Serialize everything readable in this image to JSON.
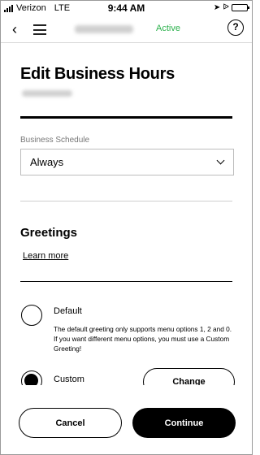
{
  "status_bar": {
    "carrier": "Verizon",
    "network": "LTE",
    "time": "9:44 AM"
  },
  "nav": {
    "back_icon": "chevron-left-icon",
    "menu_icon": "hamburger-menu-icon",
    "status": "Active",
    "status_color": "#2bb14c",
    "help_symbol": "?"
  },
  "page": {
    "title": "Edit Business Hours"
  },
  "schedule": {
    "label": "Business Schedule",
    "value": "Always"
  },
  "greetings": {
    "title": "Greetings",
    "learn_more": "Learn more",
    "options": [
      {
        "label": "Default",
        "selected": false,
        "description": "The default greeting only supports menu options 1, 2 and 0. If you want different menu options, you must use a Custom Greeting!"
      },
      {
        "label": "Custom",
        "selected": true
      }
    ],
    "change_label": "Change"
  },
  "footer": {
    "cancel_label": "Cancel",
    "continue_label": "Continue"
  }
}
